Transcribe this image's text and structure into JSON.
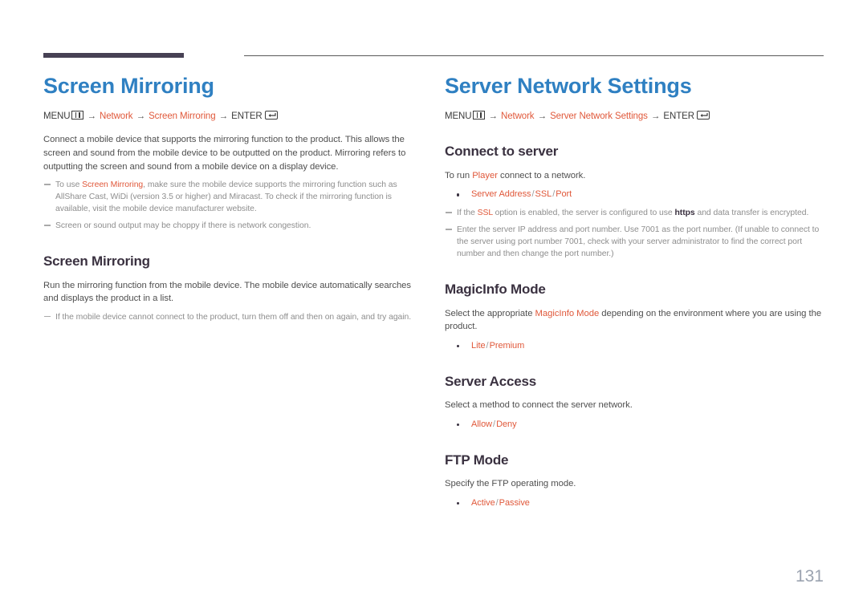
{
  "colors": {
    "title_blue": "#2f80c2",
    "accent_orange": "#e0583a",
    "heading_dark": "#3a3140",
    "note_gray": "#8e8e8e",
    "rule_dark": "#474154",
    "page_number_gray": "#9ba3b0"
  },
  "page_number": "131",
  "left": {
    "title": "Screen Mirroring",
    "menu_path": {
      "menu_label": "MENU",
      "menu_icon": "menu-grid-icon",
      "arrow1": "→",
      "item1": "Network",
      "arrow2": "→",
      "item2": "Screen Mirroring",
      "arrow3": "→",
      "enter_label": "ENTER",
      "enter_icon": "enter-return-icon"
    },
    "intro": "Connect a mobile device that supports the mirroring function to the product. This allows the screen and sound from the mobile device to be outputted on the product. Mirroring refers to outputting the screen and sound from a mobile device on a display device.",
    "notes": [
      {
        "pre": "To use ",
        "accent": "Screen Mirroring",
        "post": ", make sure the mobile device supports the mirroring function such as AllShare Cast, WiDi (version 3.5 or higher) and Miracast. To check if the mirroring function is available, visit the mobile device manufacturer website."
      },
      {
        "pre": "Screen or sound output may be choppy if there is network congestion.",
        "accent": "",
        "post": ""
      }
    ],
    "section": {
      "heading": "Screen Mirroring",
      "body": "Run the mirroring function from the mobile device. The mobile device automatically searches and displays the product in a list.",
      "note": "If the mobile device cannot connect to the product, turn them off and then on again, and try again."
    }
  },
  "right": {
    "title": "Server Network Settings",
    "menu_path": {
      "menu_label": "MENU",
      "menu_icon": "menu-grid-icon",
      "arrow1": "→",
      "item1": "Network",
      "arrow2": "→",
      "item2": "Server Network Settings",
      "arrow3": "→",
      "enter_label": "ENTER",
      "enter_icon": "enter-return-icon"
    },
    "sections": [
      {
        "heading": "Connect to server",
        "body_pre": "To run ",
        "body_accent": "Player",
        "body_post": " connect to a network.",
        "options": [
          "Server Address",
          "SSL",
          "Port"
        ],
        "notes": [
          {
            "pre": "If the ",
            "accent": "SSL",
            "mid": " option is enabled, the server is configured to use ",
            "strong": "https",
            "post": " and data transfer is encrypted."
          },
          {
            "pre": "Enter the server IP address and port number. Use 7001 as the port number. (If unable to connect to the server using port number 7001, check with your server administrator to find the correct port number and then change the port number.)",
            "accent": "",
            "mid": "",
            "strong": "",
            "post": ""
          }
        ]
      },
      {
        "heading": "MagicInfo Mode",
        "body_pre": "Select the appropriate ",
        "body_accent": "MagicInfo Mode",
        "body_post": " depending on the environment where you are using the product.",
        "options": [
          "Lite",
          "Premium"
        ],
        "notes": []
      },
      {
        "heading": "Server Access",
        "body_pre": "Select a method to connect the server network.",
        "body_accent": "",
        "body_post": "",
        "options": [
          "Allow",
          "Deny"
        ],
        "notes": []
      },
      {
        "heading": "FTP Mode",
        "body_pre": "Specify the FTP operating mode.",
        "body_accent": "",
        "body_post": "",
        "options": [
          "Active",
          "Passive"
        ],
        "notes": []
      }
    ]
  }
}
